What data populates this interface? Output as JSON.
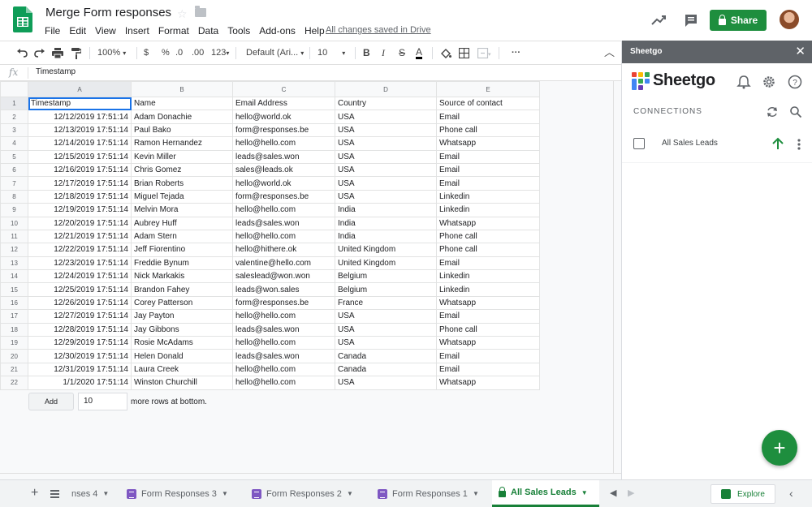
{
  "header": {
    "title": "Merge Form responses",
    "menu": [
      "File",
      "Edit",
      "View",
      "Insert",
      "Format",
      "Data",
      "Tools",
      "Add-ons",
      "Help"
    ],
    "saved_status": "All changes saved in Drive",
    "share_label": "Share"
  },
  "toolbar": {
    "zoom": "100%",
    "currency": "$",
    "percent": "%",
    "dec_decrease": ".0",
    "dec_increase": ".00",
    "more_formats": "123",
    "font": "Default (Ari...",
    "font_size": "10",
    "bold": "B",
    "italic": "I",
    "strike": "S",
    "text_color": "A",
    "more": "···"
  },
  "formula_bar": {
    "fx": "fx",
    "value": "Timestamp"
  },
  "grid": {
    "columns": [
      "A",
      "B",
      "C",
      "D",
      "E"
    ],
    "rows": [
      [
        "Timestamp",
        "Name",
        "Email Address",
        "Country",
        "Source of contact"
      ],
      [
        "12/12/2019 17:51:14",
        "Adam Donachie",
        "hello@world.ok",
        "USA",
        "Email"
      ],
      [
        "12/13/2019 17:51:14",
        "Paul Bako",
        "form@responses.be",
        "USA",
        "Phone call"
      ],
      [
        "12/14/2019 17:51:14",
        "Ramon Hernandez",
        "hello@hello.com",
        "USA",
        "Whatsapp"
      ],
      [
        "12/15/2019 17:51:14",
        "Kevin Miller",
        "leads@sales.won",
        "USA",
        "Email"
      ],
      [
        "12/16/2019 17:51:14",
        "Chris Gomez",
        "sales@leads.ok",
        "USA",
        "Email"
      ],
      [
        "12/17/2019 17:51:14",
        "Brian Roberts",
        "hello@world.ok",
        "USA",
        "Email"
      ],
      [
        "12/18/2019 17:51:14",
        "Miguel Tejada",
        "form@responses.be",
        "USA",
        "Linkedin"
      ],
      [
        "12/19/2019 17:51:14",
        "Melvin Mora",
        "hello@hello.com",
        "India",
        "Linkedin"
      ],
      [
        "12/20/2019 17:51:14",
        "Aubrey Huff",
        "leads@sales.won",
        "India",
        "Whatsapp"
      ],
      [
        "12/21/2019 17:51:14",
        "Adam Stern",
        "hello@hello.com",
        "India",
        "Phone call"
      ],
      [
        "12/22/2019 17:51:14",
        "Jeff Fiorentino",
        "hello@hithere.ok",
        "United Kingdom",
        "Phone call"
      ],
      [
        "12/23/2019 17:51:14",
        "Freddie Bynum",
        "valentine@hello.com",
        "United Kingdom",
        "Email"
      ],
      [
        "12/24/2019 17:51:14",
        "Nick Markakis",
        "saleslead@won.won",
        "Belgium",
        "Linkedin"
      ],
      [
        "12/25/2019 17:51:14",
        "Brandon Fahey",
        "leads@won.sales",
        "Belgium",
        "Linkedin"
      ],
      [
        "12/26/2019 17:51:14",
        "Corey Patterson",
        "form@responses.be",
        "France",
        "Whatsapp"
      ],
      [
        "12/27/2019 17:51:14",
        "Jay Payton",
        "hello@hello.com",
        "USA",
        "Email"
      ],
      [
        "12/28/2019 17:51:14",
        "Jay Gibbons",
        "leads@sales.won",
        "USA",
        "Phone call"
      ],
      [
        "12/29/2019 17:51:14",
        "Rosie McAdams",
        "hello@hello.com",
        "USA",
        "Whatsapp"
      ],
      [
        "12/30/2019 17:51:14",
        "Helen Donald",
        "leads@sales.won",
        "Canada",
        "Email"
      ],
      [
        "12/31/2019 17:51:14",
        "Laura Creek",
        "hello@hello.com",
        "Canada",
        "Email"
      ],
      [
        "1/1/2020 17:51:14",
        "Winston Churchill",
        "hello@hello.com",
        "USA",
        "Whatsapp"
      ]
    ],
    "add_button": "Add",
    "add_count": "10",
    "add_suffix": "more rows at bottom."
  },
  "tabs": {
    "items": [
      {
        "label": "nses 4",
        "icon": "form-icon"
      },
      {
        "label": "Form Responses 3",
        "icon": "form-icon"
      },
      {
        "label": "Form Responses 2",
        "icon": "form-icon"
      },
      {
        "label": "Form Responses 1",
        "icon": "form-icon"
      }
    ],
    "active": "All Sales Leads",
    "explore": "Explore"
  },
  "panel": {
    "title": "Sheetgo",
    "brand": "Sheetgo",
    "connections_label": "CONNECTIONS",
    "connection_name": "All Sales Leads"
  },
  "colors": {
    "accent_green": "#1e8e3e",
    "selection_blue": "#1a73e8",
    "form_purple": "#7e57c2"
  }
}
